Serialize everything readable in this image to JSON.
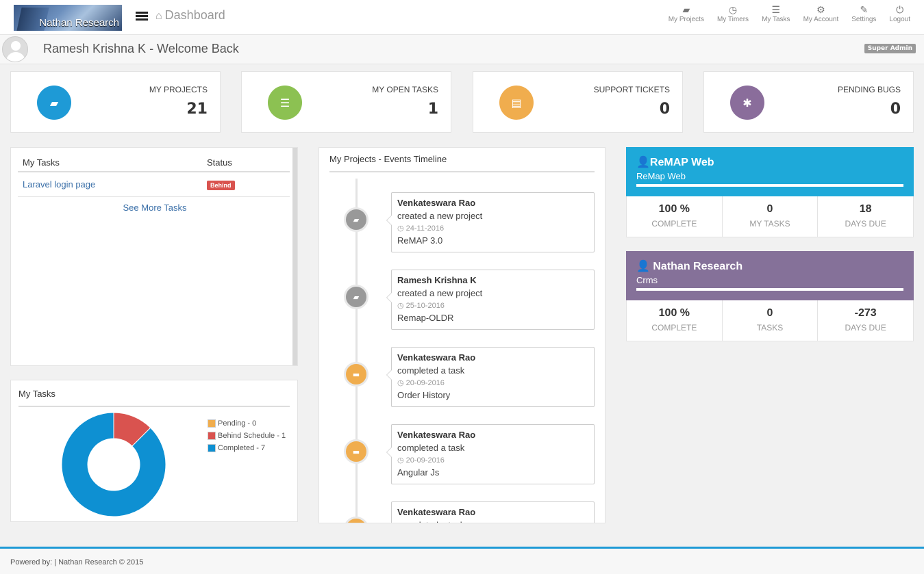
{
  "header": {
    "logo_text": "Nathan Research",
    "breadcrumb": "Dashboard",
    "nav": [
      {
        "label": "My Projects",
        "icon": "folder-icon"
      },
      {
        "label": "My Timers",
        "icon": "clock-icon"
      },
      {
        "label": "My Tasks",
        "icon": "list-icon"
      },
      {
        "label": "My Account",
        "icon": "gears-icon"
      },
      {
        "label": "Settings",
        "icon": "wrench-icon"
      },
      {
        "label": "Logout",
        "icon": "power-icon"
      }
    ]
  },
  "welcome": {
    "text": "Ramesh Krishna K - Welcome Back",
    "role_badge": "Super Admin"
  },
  "stats": [
    {
      "label": "MY PROJECTS",
      "value": "21",
      "color": "#1e9ad6",
      "icon": "folder-open-icon"
    },
    {
      "label": "MY OPEN TASKS",
      "value": "1",
      "color": "#8cc152",
      "icon": "list-icon"
    },
    {
      "label": "SUPPORT TICKETS",
      "value": "0",
      "color": "#f0ad4e",
      "icon": "file-icon"
    },
    {
      "label": "PENDING BUGS",
      "value": "0",
      "color": "#8a6d9b",
      "icon": "bug-icon"
    }
  ],
  "tasks": {
    "col_task": "My Tasks",
    "col_status": "Status",
    "rows": [
      {
        "name": "Laravel login page",
        "status": "Behind"
      }
    ],
    "see_more": "See More Tasks"
  },
  "task_chart": {
    "title": "My Tasks",
    "legend": [
      "Pending - 0",
      "Behind Schedule - 1",
      "Completed - 7"
    ]
  },
  "chart_data": {
    "type": "pie",
    "categories": [
      "Pending",
      "Behind Schedule",
      "Completed"
    ],
    "values": [
      0,
      1,
      7
    ],
    "colors": [
      "#f0ad4e",
      "#d9534f",
      "#0e90d2"
    ],
    "title": "My Tasks",
    "legend_position": "right"
  },
  "timeline": {
    "title": "My Projects - Events Timeline",
    "events": [
      {
        "who": "Venkateswara Rao",
        "what": "created a new project",
        "date": "24-11-2016",
        "project": "ReMAP 3.0",
        "kind": "project",
        "color": "#999999"
      },
      {
        "who": "Ramesh Krishna K",
        "what": "created a new project",
        "date": "25-10-2016",
        "project": "Remap-OLDR",
        "kind": "project",
        "color": "#999999"
      },
      {
        "who": "Venkateswara Rao",
        "what": "completed a task",
        "date": "20-09-2016",
        "project": "Order History",
        "kind": "task",
        "color": "#f0ad4e"
      },
      {
        "who": "Venkateswara Rao",
        "what": "completed a task",
        "date": "20-09-2016",
        "project": "Angular Js",
        "kind": "task",
        "color": "#f0ad4e"
      },
      {
        "who": "Venkateswara Rao",
        "what": "completed a task",
        "date": "",
        "project": "",
        "kind": "task",
        "color": "#f0ad4e"
      }
    ]
  },
  "projects": [
    {
      "name": "ReMAP Web",
      "sub": "ReMap Web",
      "color": "#1ea9d9",
      "stats": [
        {
          "v": "100 %",
          "k": "COMPLETE"
        },
        {
          "v": "0",
          "k": "MY TASKS"
        },
        {
          "v": "18",
          "k": "DAYS DUE"
        }
      ]
    },
    {
      "name": "Nathan Research",
      "sub": "Crms",
      "color": "#857199",
      "stats": [
        {
          "v": "100 %",
          "k": "COMPLETE"
        },
        {
          "v": "0",
          "k": "TASKS"
        },
        {
          "v": "-273",
          "k": "DAYS DUE"
        }
      ]
    }
  ],
  "footer": {
    "text": "Powered by: | Nathan Research © 2015"
  }
}
